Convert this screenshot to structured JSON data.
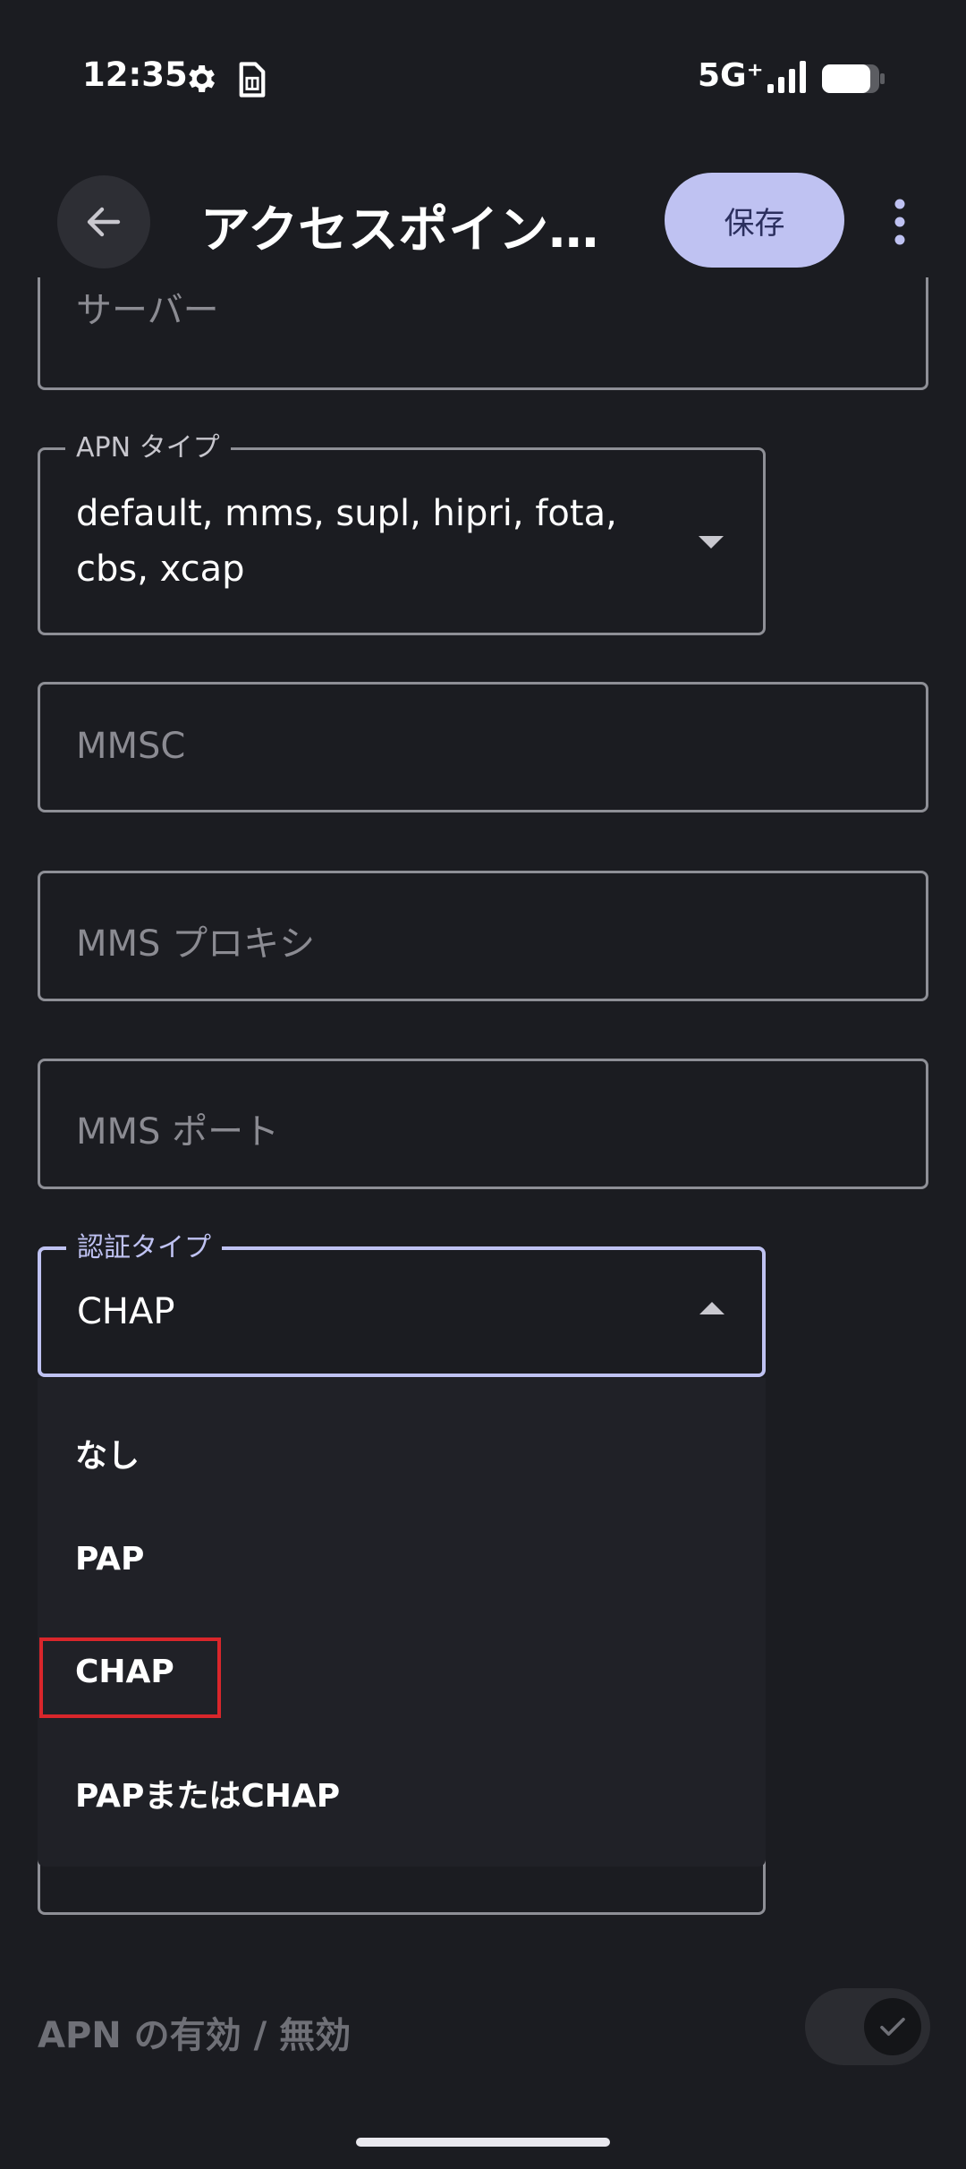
{
  "status_bar": {
    "time": "12:35",
    "network": "5G⁺",
    "icons": [
      "gear-icon",
      "sim-card-icon",
      "signal-icon",
      "battery-icon"
    ]
  },
  "app_bar": {
    "back_icon": "arrow-left-icon",
    "title": "アクセスポイン...",
    "save_label": "保存",
    "more_icon": "more-vert-icon"
  },
  "form": {
    "server": {
      "placeholder": "サーバー"
    },
    "apn_type": {
      "label": "APN タイプ",
      "value_line1": "default, mms, supl, hipri, fota,",
      "value_line2": "cbs, xcap"
    },
    "mmsc": {
      "placeholder": "MMSC"
    },
    "mms_proxy": {
      "placeholder": "MMS プロキシ"
    },
    "mms_port": {
      "placeholder": "MMS ポート"
    },
    "auth_type": {
      "label": "認証タイプ",
      "value": "CHAP",
      "options": [
        "なし",
        "PAP",
        "CHAP",
        "PAPまたはCHAP"
      ]
    },
    "apn_enable": {
      "label": "APN の有効 / 無効",
      "checked": true
    }
  },
  "colors": {
    "background": "#1b1c21",
    "accent": "#bfc2f2",
    "highlight": "#d9262b"
  }
}
